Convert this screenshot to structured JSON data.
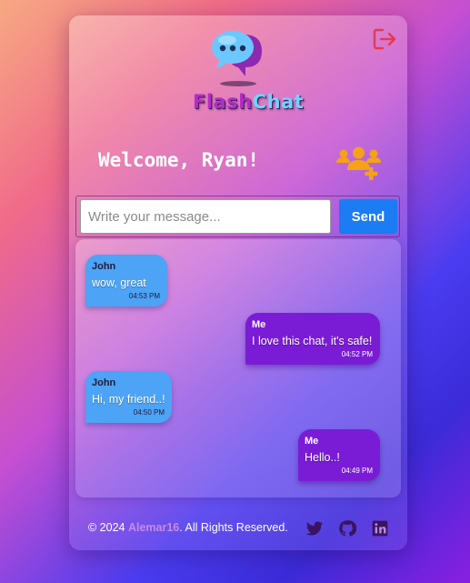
{
  "app": {
    "brand_part1": "Flash",
    "brand_part2": "Chat"
  },
  "header": {
    "welcome": "Welcome, Ryan!"
  },
  "compose": {
    "placeholder": "Write your message...",
    "value": "",
    "send_label": "Send"
  },
  "messages": [
    {
      "sender": "John",
      "text": "wow, great",
      "time": "04:53 PM",
      "from_me": false
    },
    {
      "sender": "Me",
      "text": "I love this chat, it's safe!",
      "time": "04:52 PM",
      "from_me": true
    },
    {
      "sender": "John",
      "text": "Hi, my friend..!",
      "time": "04:50 PM",
      "from_me": false
    },
    {
      "sender": "Me",
      "text": "Hello..!",
      "time": "04:49 PM",
      "from_me": true
    }
  ],
  "footer": {
    "copyright": "© 2024 ",
    "author": "Alemar16",
    "rights": ". All Rights Reserved."
  },
  "icons": {
    "logout": "logout-icon",
    "logo": "chat-bubble-logo",
    "add_users": "add-users-icon",
    "twitter": "twitter-icon",
    "github": "github-icon",
    "linkedin": "linkedin-icon"
  },
  "colors": {
    "send_button": "#1b7cf3",
    "bubble_other": "#4da3f5",
    "bubble_me": "#7a1cd6",
    "accent_orange": "#f5a21b",
    "logout_red": "#e8394a"
  }
}
